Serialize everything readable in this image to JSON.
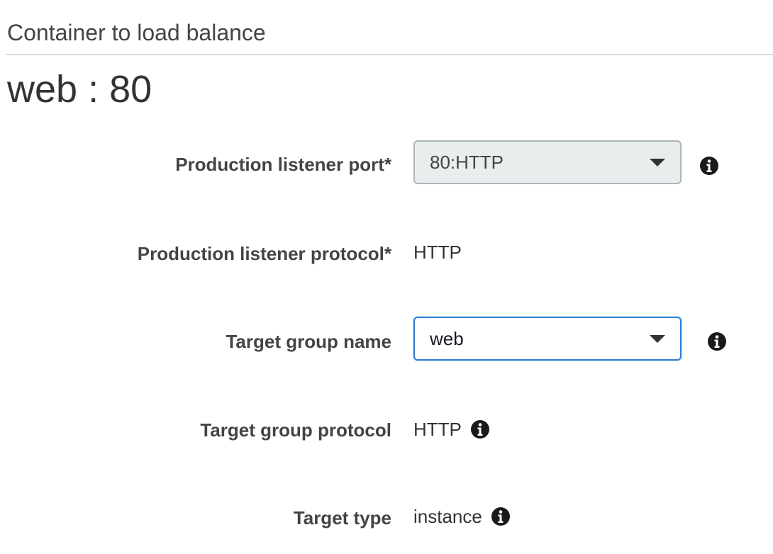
{
  "section": {
    "title": "Container to load balance",
    "container_name": "web : 80"
  },
  "fields": {
    "production_listener_port": {
      "label": "Production listener port*",
      "value": "80:HTTP",
      "disabled": true,
      "icon": "info-icon"
    },
    "production_listener_protocol": {
      "label": "Production listener protocol*",
      "value": "HTTP"
    },
    "target_group_name": {
      "label": "Target group name",
      "value": "web",
      "focused": true,
      "icon": "info-icon"
    },
    "target_group_protocol": {
      "label": "Target group protocol",
      "value": "HTTP",
      "icon": "info-icon"
    },
    "target_type": {
      "label": "Target type",
      "value": "instance",
      "icon": "info-icon"
    }
  },
  "colors": {
    "focus_border": "#2f80d1",
    "disabled_bg": "#eaeded",
    "label_text": "#444444",
    "divider": "#d5dbdb"
  }
}
